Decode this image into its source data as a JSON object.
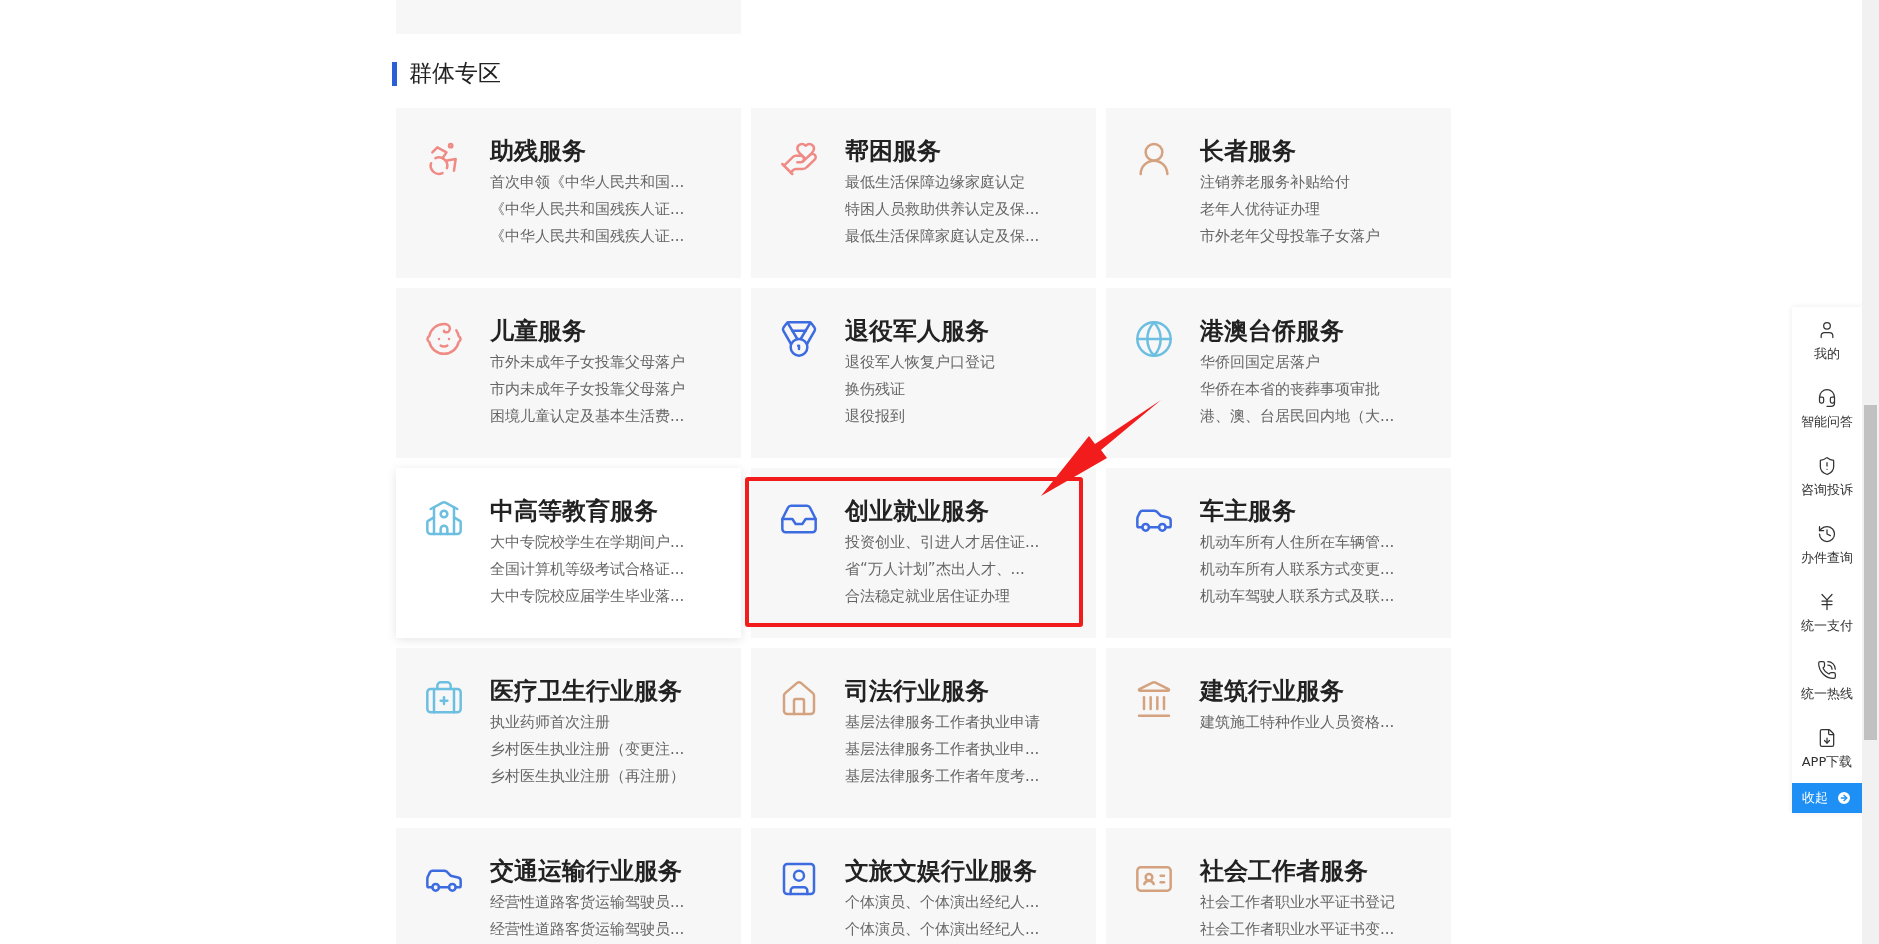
{
  "section": {
    "title": "群体专区"
  },
  "cards": [
    {
      "title": "助残服务",
      "color": "#f08a84",
      "hovered": false,
      "marked": false,
      "lines": [
        "首次申领《中华人民共和国...",
        "《中华人民共和国残疾人证...",
        "《中华人民共和国残疾人证..."
      ]
    },
    {
      "title": "帮困服务",
      "color": "#f08a84",
      "hovered": false,
      "marked": false,
      "lines": [
        "最低生活保障边缘家庭认定",
        "特困人员救助供养认定及保...",
        "最低生活保障家庭认定及保..."
      ]
    },
    {
      "title": "长者服务",
      "color": "#d4a27f",
      "hovered": false,
      "marked": false,
      "lines": [
        "注销养老服务补贴给付",
        "老年人优待证办理",
        "市外老年父母投靠子女落户"
      ]
    },
    {
      "title": "儿童服务",
      "color": "#f08a84",
      "hovered": false,
      "marked": false,
      "lines": [
        "市外未成年子女投靠父母落户",
        "市内未成年子女投靠父母落户",
        "困境儿童认定及基本生活费..."
      ]
    },
    {
      "title": "退役军人服务",
      "color": "#3d6be0",
      "hovered": false,
      "marked": false,
      "lines": [
        "退役军人恢复户口登记",
        "换伤残证",
        "退役报到"
      ]
    },
    {
      "title": "港澳台侨服务",
      "color": "#6cbfe0",
      "hovered": false,
      "marked": false,
      "lines": [
        "华侨回国定居落户",
        "华侨在本省的丧葬事项审批",
        "港、澳、台居民回内地（大..."
      ]
    },
    {
      "title": "中高等教育服务",
      "color": "#6cbfe0",
      "hovered": true,
      "marked": false,
      "lines": [
        "大中专院校学生在学期间户...",
        "全国计算机等级考试合格证...",
        "大中专院校应届学生毕业落..."
      ]
    },
    {
      "title": "创业就业服务",
      "color": "#3d6be0",
      "hovered": false,
      "marked": true,
      "lines": [
        "投资创业、引进人才居住证...",
        "省“万人计划”杰出人才、...",
        "合法稳定就业居住证办理"
      ]
    },
    {
      "title": "车主服务",
      "color": "#3d6be0",
      "hovered": false,
      "marked": false,
      "lines": [
        "机动车所有人住所在车辆管...",
        "机动车所有人联系方式变更...",
        "机动车驾驶人联系方式及联..."
      ]
    },
    {
      "title": "医疗卫生行业服务",
      "color": "#6cbfe0",
      "hovered": false,
      "marked": false,
      "lines": [
        "执业药师首次注册",
        "乡村医生执业注册（变更注...",
        "乡村医生执业注册（再注册）"
      ]
    },
    {
      "title": "司法行业服务",
      "color": "#d4a27f",
      "hovered": false,
      "marked": false,
      "lines": [
        "基层法律服务工作者执业申请",
        "基层法律服务工作者执业申...",
        "基层法律服务工作者年度考..."
      ]
    },
    {
      "title": "建筑行业服务",
      "color": "#d4a27f",
      "hovered": false,
      "marked": false,
      "lines": [
        "建筑施工特种作业人员资格..."
      ]
    },
    {
      "title": "交通运输行业服务",
      "color": "#3d6be0",
      "hovered": false,
      "marked": false,
      "lines": [
        "经营性道路客货运输驾驶员...",
        "经营性道路客货运输驾驶员..."
      ]
    },
    {
      "title": "文旅文娱行业服务",
      "color": "#3d6be0",
      "hovered": false,
      "marked": false,
      "lines": [
        "个体演员、个体演出经纪人...",
        "个体演员、个体演出经纪人..."
      ]
    },
    {
      "title": "社会工作者服务",
      "color": "#d4a27f",
      "hovered": false,
      "marked": false,
      "lines": [
        "社会工作者职业水平证书登记",
        "社会工作者职业水平证书变..."
      ]
    }
  ],
  "sidebar": {
    "items": [
      {
        "label": "我的"
      },
      {
        "label": "智能问答"
      },
      {
        "label": "咨询投诉"
      },
      {
        "label": "办件查询"
      },
      {
        "label": "统一支付"
      },
      {
        "label": "统一热线"
      },
      {
        "label": "APP下载"
      }
    ],
    "collapse": {
      "label": "收起"
    }
  }
}
